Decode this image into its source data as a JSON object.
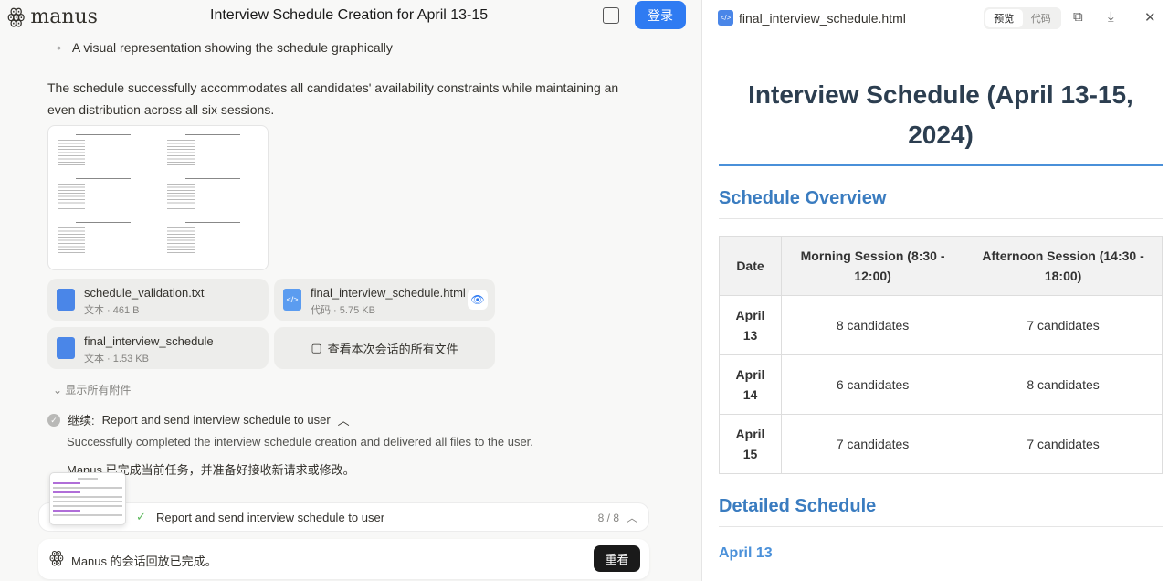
{
  "header": {
    "brand": "manus",
    "title": "Interview Schedule Creation for April 13-15",
    "login_label": "登录"
  },
  "chat": {
    "bullet": "A visual representation showing the schedule graphically",
    "summary": "The schedule successfully accommodates all candidates' availability constraints while maintaining an even distribution across all six sessions.",
    "attachments": [
      {
        "name": "schedule_validation.txt",
        "meta": "文本 · 461 B",
        "icon": "document-icon"
      },
      {
        "name": "final_interview_schedule.html",
        "meta": "代码 · 5.75 KB",
        "icon": "code-file-icon"
      },
      {
        "name": "final_interview_schedule",
        "meta": "文本 · 1.53 KB",
        "icon": "document-icon"
      }
    ],
    "view_all_files": "查看本次会话的所有文件",
    "show_all_attachments": "显示所有附件",
    "step_prefix": "继续:",
    "step_title": "Report and send interview schedule to user",
    "step_desc": "Successfully completed the interview schedule creation and delivered all files to the user.",
    "done_message": "Manus 已完成当前任务，并准备好接收新请求或修改。",
    "progress": {
      "label": "Report and send interview schedule to user",
      "count": "8 / 8"
    },
    "replay": {
      "text": "Manus 的会话回放已完成。",
      "button": "重看"
    }
  },
  "viewer": {
    "filename": "final_interview_schedule.html",
    "tabs": [
      "预览",
      "代码"
    ],
    "active_tab": "预览",
    "doc": {
      "title": "Interview Schedule (April 13-15, 2024)",
      "overview_heading": "Schedule Overview",
      "table": {
        "headers": [
          "Date",
          "Morning Session (8:30 - 12:00)",
          "Afternoon Session (14:30 - 18:00)"
        ],
        "rows": [
          [
            "April 13",
            "8 candidates",
            "7 candidates"
          ],
          [
            "April 14",
            "6 candidates",
            "8 candidates"
          ],
          [
            "April 15",
            "7 candidates",
            "7 candidates"
          ]
        ]
      },
      "detailed_heading": "Detailed Schedule",
      "sub_heading": "April 13"
    }
  },
  "colors": {
    "accent": "#2f7bf2",
    "heading": "#3a7cc0",
    "title": "#2c3e50"
  }
}
